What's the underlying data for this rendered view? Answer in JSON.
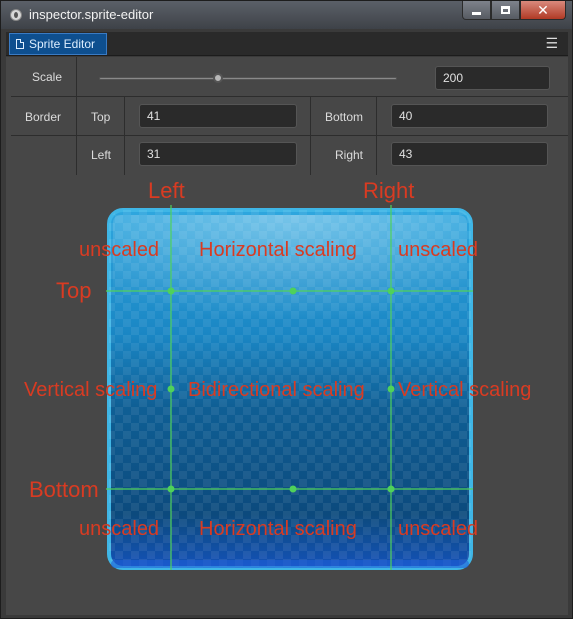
{
  "window": {
    "title": "inspector.sprite-editor"
  },
  "tab": {
    "label": "Sprite Editor"
  },
  "scale": {
    "label": "Scale",
    "value": "200",
    "slider_fraction": 0.4
  },
  "border": {
    "label": "Border",
    "top": {
      "label": "Top",
      "value": "41"
    },
    "bottom": {
      "label": "Bottom",
      "value": "40"
    },
    "left": {
      "label": "Left",
      "value": "31"
    },
    "right": {
      "label": "Right",
      "value": "43"
    }
  },
  "annotations": {
    "left": "Left",
    "right": "Right",
    "top": "Top",
    "bottom": "Bottom",
    "unscaled": "unscaled",
    "horizontal": "Horizontal scaling",
    "vertical": "Vertical scaling",
    "bidirectional": "Bidirectional scaling"
  },
  "colors": {
    "annotation": "#d93b22",
    "guide": "#4fd15a",
    "tab_active": "#0e4f8f"
  }
}
